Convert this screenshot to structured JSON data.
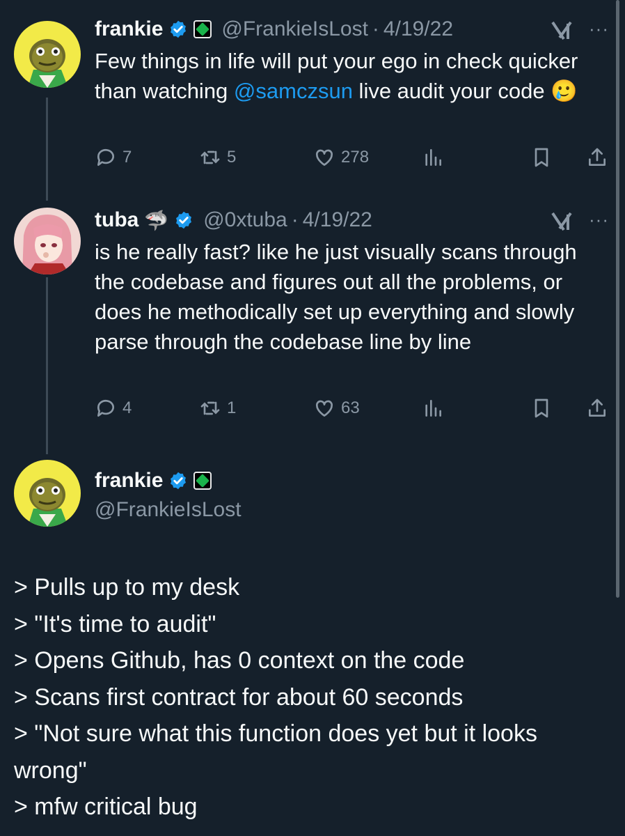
{
  "tweets": [
    {
      "name": "frankie",
      "handle": "@FrankieIsLost",
      "dot": "·",
      "date": "4/19/22",
      "text_before": "Few things in life will put your ego in check quicker than watching ",
      "mention": "@samczsun",
      "text_after": " live audit your code ",
      "emoji": "🥲",
      "replies": "7",
      "retweets": "5",
      "likes": "278",
      "more": "···"
    },
    {
      "name": "tuba",
      "name_emoji": "🦈",
      "handle": "@0xtuba",
      "dot": "·",
      "date": "4/19/22",
      "text": "is he really fast? like he just visually scans through the codebase and figures out all the problems, or does he methodically set up everything and slowly parse through the codebase line by line",
      "replies": "4",
      "retweets": "1",
      "likes": "63",
      "more": "···"
    }
  ],
  "main": {
    "name": "frankie",
    "handle": "@FrankieIsLost",
    "lines": [
      "> Pulls up to my desk",
      "> \"It's time to audit\"",
      "> Opens Github, has 0 context on the code",
      "> Scans first contract for about 60 seconds",
      "> \"Not sure what this function does yet but it looks wrong\"",
      "> mfw critical bug"
    ]
  },
  "colors": {
    "background": "#15202b",
    "text": "#f7f9f9",
    "secondary": "#8b98a5",
    "accent": "#1d9bf0"
  },
  "icons": [
    "verified-badge-icon",
    "affiliate-badge-icon",
    "grok-icon",
    "reply-icon",
    "retweet-icon",
    "like-icon",
    "views-icon",
    "bookmark-icon",
    "share-icon"
  ]
}
